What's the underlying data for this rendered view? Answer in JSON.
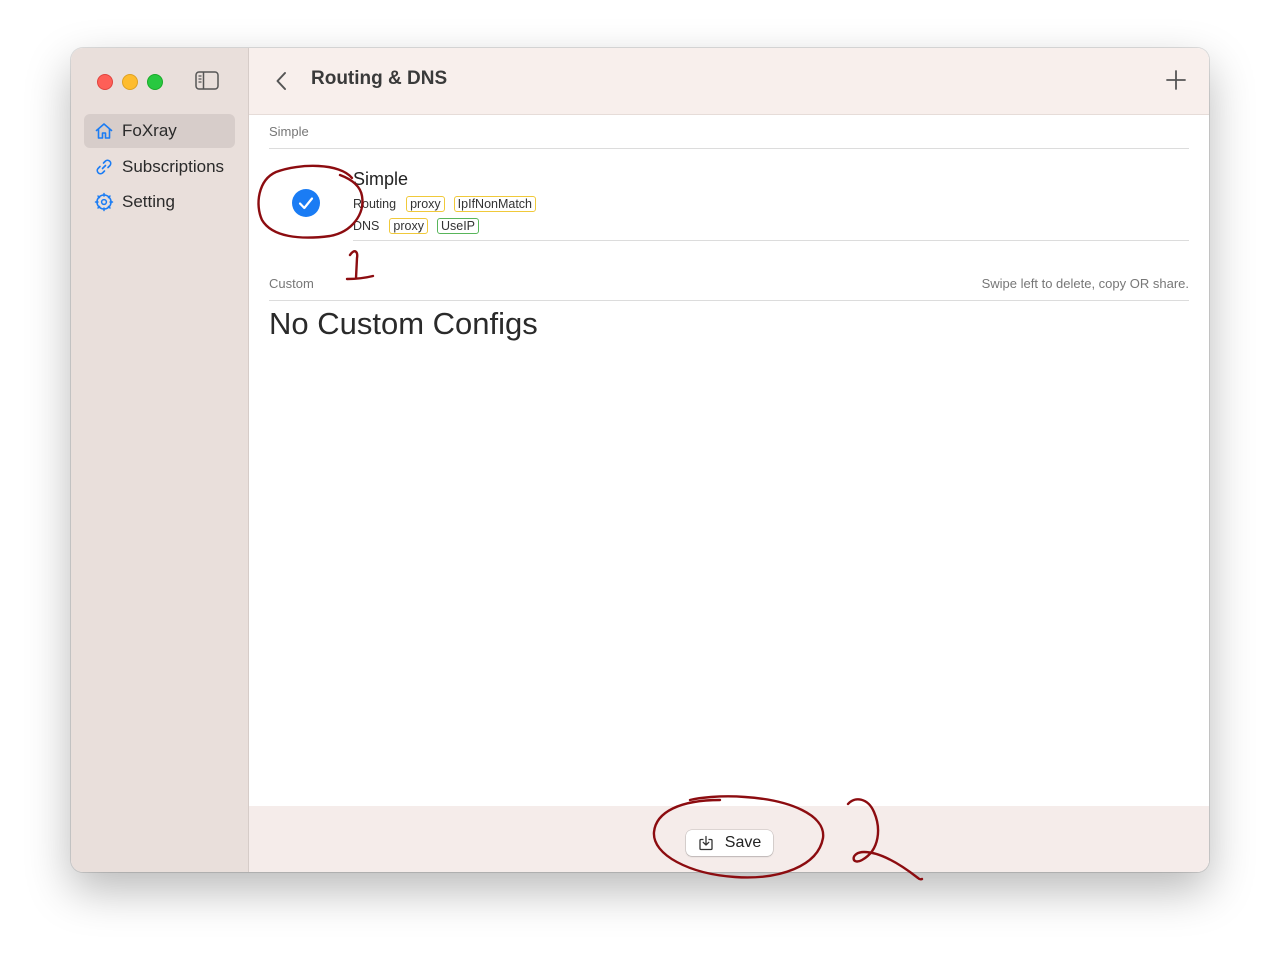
{
  "sidebar": {
    "items": [
      {
        "label": "FoXray",
        "icon": "house-icon",
        "active": true
      },
      {
        "label": "Subscriptions",
        "icon": "link-icon",
        "active": false
      },
      {
        "label": "Setting",
        "icon": "gear-icon",
        "active": false
      }
    ]
  },
  "header": {
    "title": "Routing & DNS"
  },
  "simple_section": {
    "header": "Simple",
    "config": {
      "name": "Simple",
      "selected": true,
      "routing_label": "Routing",
      "routing_tags": [
        "proxy",
        "IpIfNonMatch"
      ],
      "dns_label": "DNS",
      "dns_tags": [
        "proxy",
        "UseIP"
      ]
    }
  },
  "custom_section": {
    "header": "Custom",
    "hint": "Swipe left to delete, copy OR share.",
    "empty_text": "No Custom Configs"
  },
  "footer": {
    "save_label": "Save"
  },
  "annotations": {
    "label_1": "1",
    "label_2": "2"
  },
  "colors": {
    "accent": "#1a7cf4",
    "sidebar_bg": "#e9dfdb",
    "titlebar_bg": "#f8efec",
    "annotation": "#8c0c10",
    "tag_yellow": "#f0c93a",
    "tag_green": "#58b55a"
  }
}
